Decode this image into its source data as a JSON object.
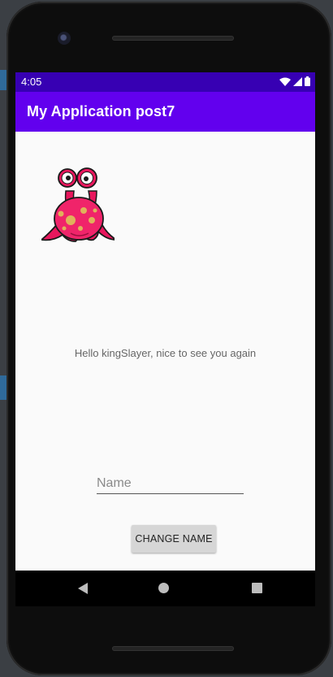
{
  "status_bar": {
    "time": "4:05",
    "icons": [
      "wifi-icon",
      "signal-icon",
      "battery-icon"
    ]
  },
  "app_bar": {
    "title": "My Application post7"
  },
  "content": {
    "image": "monster-image",
    "greeting": "Hello kingSlayer, nice to see you again",
    "name_input": {
      "placeholder": "Name",
      "value": ""
    },
    "change_button_label": "CHANGE NAME"
  },
  "navigation_bar": {
    "buttons": [
      "back-icon",
      "home-icon",
      "recents-icon"
    ]
  },
  "colors": {
    "status_bar": "#3700b3",
    "app_bar": "#6200ee",
    "screen_background": "#fafafa",
    "button_background": "#d6d6d6"
  }
}
